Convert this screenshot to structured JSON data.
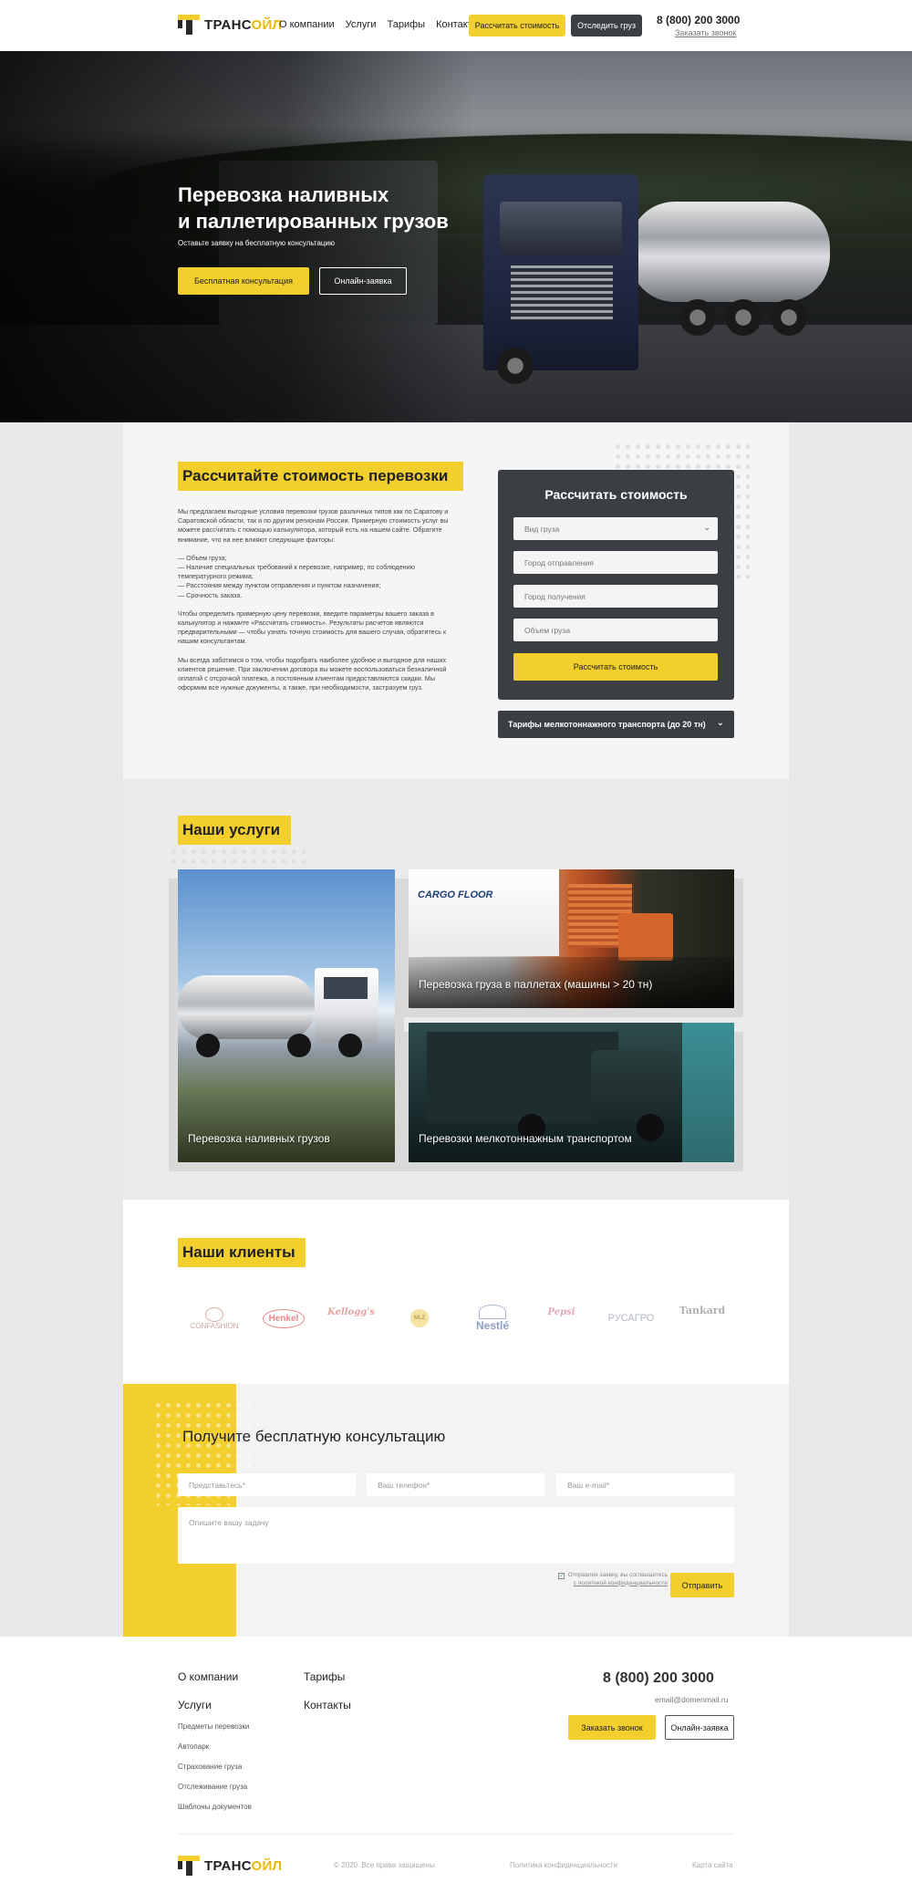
{
  "header": {
    "logo_part1": "ТРАНС",
    "logo_part2": "ОЙЛ",
    "nav": [
      "О компании",
      "Услуги",
      "Тарифы",
      "Контакты"
    ],
    "btn_calc": "Рассчитать стоимость",
    "btn_track": "Отследить груз",
    "phone": "8 (800) 200 3000",
    "call_link": "Заказать звонок"
  },
  "hero": {
    "title_line1": "Перевозка наливных",
    "title_line2": "и паллетированных грузов",
    "subtitle": "Оставьте заявку на бесплатную консультацию",
    "btn_consult": "Бесплатная консультация",
    "btn_online": "Онлайн-заявка"
  },
  "calc": {
    "title": "Рассчитайте стоимость перевозки",
    "paragraphs": [
      "Мы предлагаем выгодные условия перевозки грузов различных типов как по Саратову и Саратовской области, так и по другим регионам России. Примерную стоимость услуг вы можете рассчитать с помощью калькулятора, который есть на нашем сайте. Обратите внимание, что на нее влияют следующие факторы:",
      "— Объем груза;\n— Наличие специальных требований к перевозке, например, по соблюдению температурного режима;\n— Расстояния между пунктом отправления и пунктом назначения;\n— Срочность заказа.",
      "Чтобы определить примерную цену перевозки, введите параметры вашего заказа в калькулятор и нажмите «Рассчитать стоимость». Результаты расчетов являются предварительными — чтобы узнать точную стоимость для вашего случая, обратитесь к нашим консультантам.",
      "Мы всегда заботимся о том, чтобы подобрать наиболее удобное и выгодное для наших клиентов решение. При заключении договора вы можете воспользоваться безналичной оплатой с отсрочкой платежа, а постоянным клиентам предоставляются скидки. Мы оформим все нужные документы, а также, при необходимости, застрахуем груз."
    ],
    "card_title": "Рассчитать стоимость",
    "field_cargo": "Вид груза",
    "field_from": "Город отправления",
    "field_to": "Город получения",
    "field_volume": "Объем груза",
    "submit": "Рассчитать стоимость",
    "tariffs": "Тарифы мелкотоннажного транспорта (до 20 тн)"
  },
  "services": {
    "title": "Наши услуги",
    "cards": [
      "Перевозка наливных грузов",
      "Перевозка груза в паллетах (машины > 20 тн)",
      "Перевозки мелкотоннажным транспортом"
    ],
    "cargo_floor": "CARGO FLOOR"
  },
  "clients": {
    "title": "Наши клиенты",
    "logos": [
      "CONFASHION",
      "Henkel",
      "Kellogg's",
      "MLZ",
      "Nestlé",
      "Pepsi",
      "РУСАГРО",
      "Tankard"
    ]
  },
  "consult": {
    "title": "Получите бесплатную консультацию",
    "ph_name": "Представьтесь*",
    "ph_phone": "Ваш телефон*",
    "ph_email": "Ваш e-mail*",
    "ph_task": "Опишите вашу задачу",
    "consent_line1": "Отправляя заявку, вы соглашаетесь",
    "consent_line2": "с политикой конфиденциальности",
    "send": "Отправить"
  },
  "footer": {
    "col1_title": "О компании",
    "col1_sub": "Услуги",
    "col1_items": [
      "Предметы перевозки",
      "Автопарк",
      "Страхование груза",
      "Отслеживание груза",
      "Шаблоны документов"
    ],
    "col2_title": "Тарифы",
    "col2_sub": "Контакты",
    "phone": "8 (800) 200 3000",
    "email": "email@domenmail.ru",
    "btn_call": "Заказать звонок",
    "btn_online": "Онлайн-заявка",
    "copyright": "© 2020. Все права защищены",
    "privacy": "Политика конфиденциальности",
    "sitemap": "Карта сайта"
  },
  "colors": {
    "accent": "#f2cf2d",
    "dark": "#3b3f44"
  }
}
